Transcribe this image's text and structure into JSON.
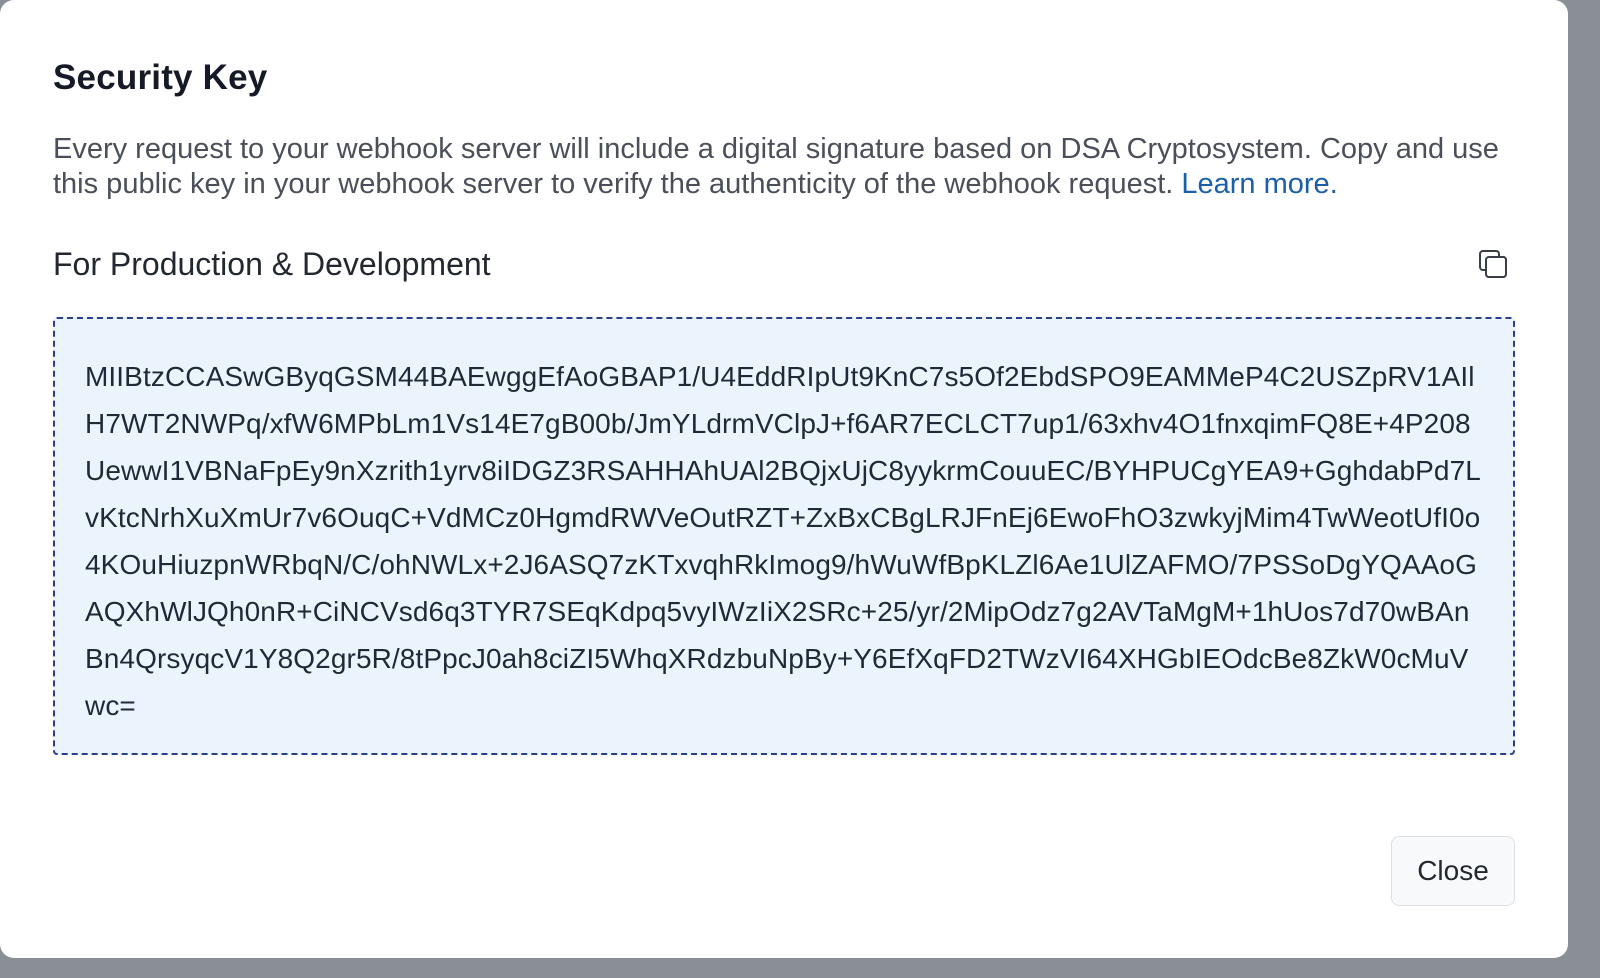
{
  "dialog": {
    "title": "Security Key",
    "description": "Every request to your webhook server will include a digital signature based on DSA Cryptosystem. Copy and use this public key in your webhook server to verify the authenticity of the webhook request.",
    "learn_more": "Learn more.",
    "section_title": "For Production & Development",
    "copy_icon": "copy-icon",
    "public_key": "MIIBtzCCASwGByqGSM44BAEwggEfAoGBAP1/U4EddRIpUt9KnC7s5Of2EbdSPO9EAMMeP4C2USZpRV1AIlH7WT2NWPq/xfW6MPbLm1Vs14E7gB00b/JmYLdrmVClpJ+f6AR7ECLCT7up1/63xhv4O1fnxqimFQ8E+4P208UewwI1VBNaFpEy9nXzrith1yrv8iIDGZ3RSAHHAhUAl2BQjxUjC8yykrmCouuEC/BYHPUCgYEA9+GghdabPd7LvKtcNrhXuXmUr7v6OuqC+VdMCz0HgmdRWVeOutRZT+ZxBxCBgLRJFnEj6EwoFhO3zwkyjMim4TwWeotUfI0o4KOuHiuzpnWRbqN/C/ohNWLx+2J6ASQ7zKTxvqhRkImog9/hWuWfBpKLZl6Ae1UlZAFMO/7PSSoDgYQAAoGAQXhWlJQh0nR+CiNCVsd6q3TYR7SEqKdpq5vyIWzIiX2SRc+25/yr/2MipOdz7g2AVTaMgM+1hUos7d70wBAnBn4QrsyqcV1Y8Q2gr5R/8tPpcJ0ah8ciZI5WhqXRdzbuNpBy+Y6EfXqFD2TWzVI64XHGbIEOdcBe8ZkW0cMuVwc=",
    "close_label": "Close"
  }
}
